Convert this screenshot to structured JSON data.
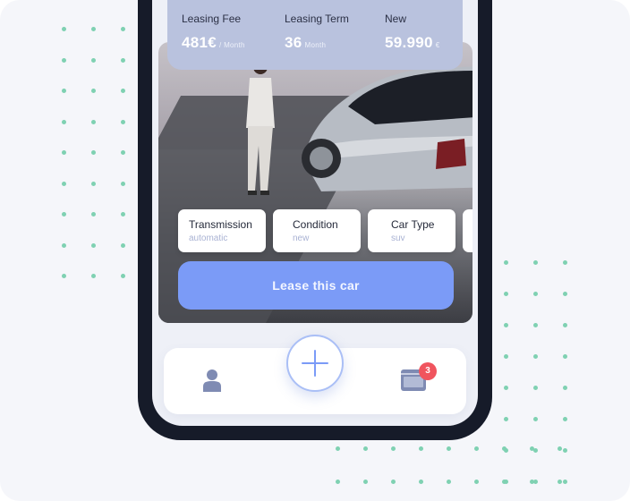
{
  "leasing": {
    "fee_label": "Leasing Fee",
    "fee_value": "481€",
    "fee_unit": "/ Month",
    "term_label": "Leasing Term",
    "term_value": "36",
    "term_unit": "Month",
    "price_label": "New",
    "price_value": "59.990",
    "price_unit": "€"
  },
  "specs": [
    {
      "title": "Transmission",
      "value": "automatic"
    },
    {
      "title": "Condition",
      "value": "new"
    },
    {
      "title": "Car Type",
      "value": "suv"
    }
  ],
  "pager": {
    "count": 3,
    "active_index": 0
  },
  "lease_button": {
    "label": "Lease this car"
  },
  "nav": {
    "user_icon": "user-icon",
    "add_icon": "plus-icon",
    "cart_icon": "cart-icon",
    "cart_badge": "3"
  },
  "colors": {
    "accent": "#7b9bf7",
    "fee_card": "#b9c2de",
    "badge": "#f0545e",
    "dots": "#7fd1b2",
    "phone_frame": "#161b29"
  }
}
